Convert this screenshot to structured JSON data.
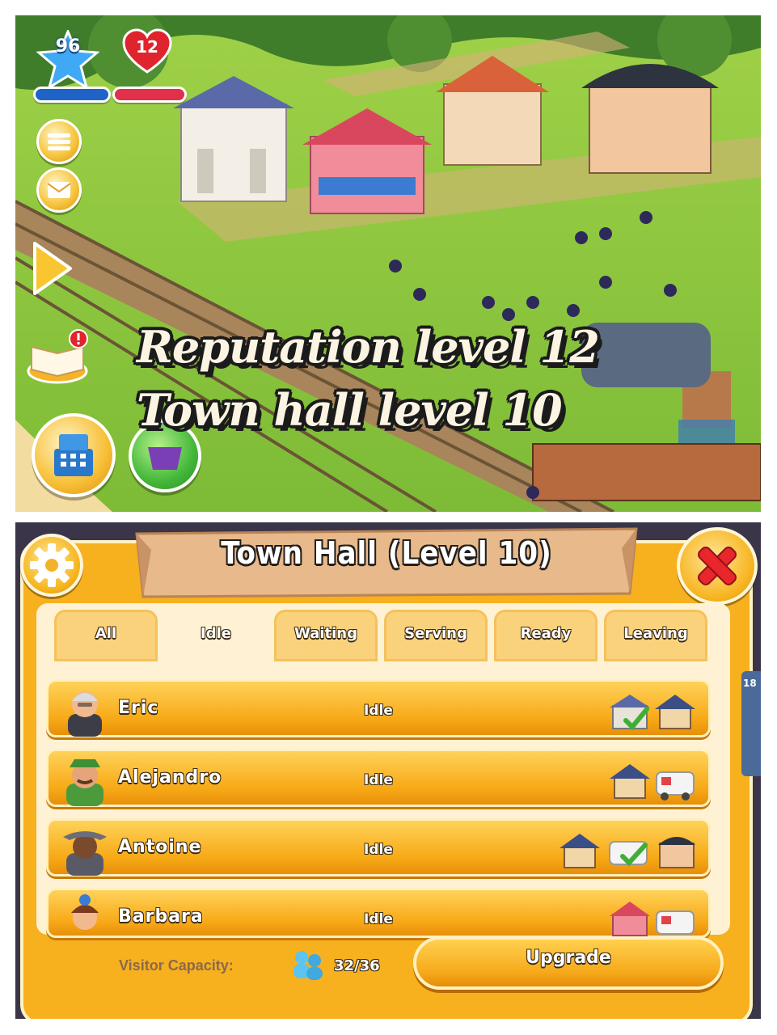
{
  "scene": {
    "level": "96",
    "reputation": "12",
    "xp_progress": 1.0,
    "reputation_progress": 1.0,
    "headline_line1": "Reputation level 12",
    "headline_line2": "Town hall level 10",
    "icons": [
      "level-star-icon",
      "reputation-heart-icon",
      "menu-icon",
      "mail-icon",
      "play-icon",
      "book-icon",
      "cash-register-icon",
      "shop-icon"
    ]
  },
  "town_hall": {
    "title": "Town Hall (Level 10)",
    "tabs": [
      {
        "label": "All",
        "active": false
      },
      {
        "label": "Idle",
        "active": true
      },
      {
        "label": "Waiting",
        "active": false
      },
      {
        "label": "Serving",
        "active": false
      },
      {
        "label": "Ready",
        "active": false
      },
      {
        "label": "Leaving",
        "active": false
      }
    ],
    "visitors": [
      {
        "name": "Eric",
        "status": "Idle",
        "buildings": [
          "town-hall-icon",
          "house-icon"
        ]
      },
      {
        "name": "Alejandro",
        "status": "Idle",
        "buildings": [
          "house-icon",
          "camper-icon"
        ]
      },
      {
        "name": "Antoine",
        "status": "Idle",
        "buildings": [
          "house-icon",
          "camper-icon",
          "shop-icon"
        ]
      },
      {
        "name": "Barbara",
        "status": "Idle",
        "buildings": [
          "fruit-shop-icon",
          "camper-icon"
        ]
      }
    ],
    "capacity_label": "Visitor Capacity:",
    "capacity_value": "32/36",
    "upgrade_label": "Upgrade",
    "side_peek": "18"
  },
  "colors": {
    "panel": "#f7b01e",
    "panel_inner": "#fff2d4",
    "row": "#f7a916",
    "grass": "#8cc63f",
    "close_red": "#e8262b"
  }
}
